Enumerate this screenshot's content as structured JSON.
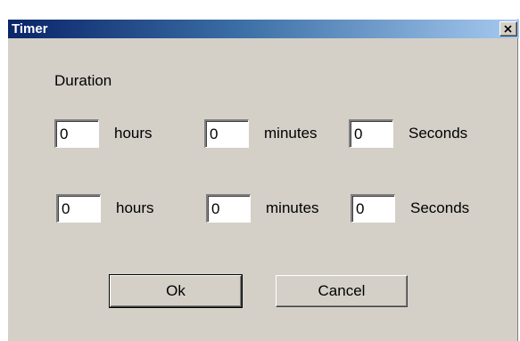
{
  "window": {
    "title": "Timer"
  },
  "duration_label": "Duration",
  "rows": [
    {
      "hours_value": "0",
      "hours_label": "hours",
      "minutes_value": "0",
      "minutes_label": "minutes",
      "seconds_value": "0",
      "seconds_label": "Seconds"
    },
    {
      "hours_value": "0",
      "hours_label": "hours",
      "minutes_value": "0",
      "minutes_label": "minutes",
      "seconds_value": "0",
      "seconds_label": "Seconds"
    }
  ],
  "buttons": {
    "ok_label": "Ok",
    "cancel_label": "Cancel"
  },
  "icons": {
    "close": "close-icon"
  },
  "colors": {
    "title_gradient_start": "#0a246a",
    "title_gradient_end": "#a6caf0",
    "dialog_face": "#d4d0c8"
  }
}
